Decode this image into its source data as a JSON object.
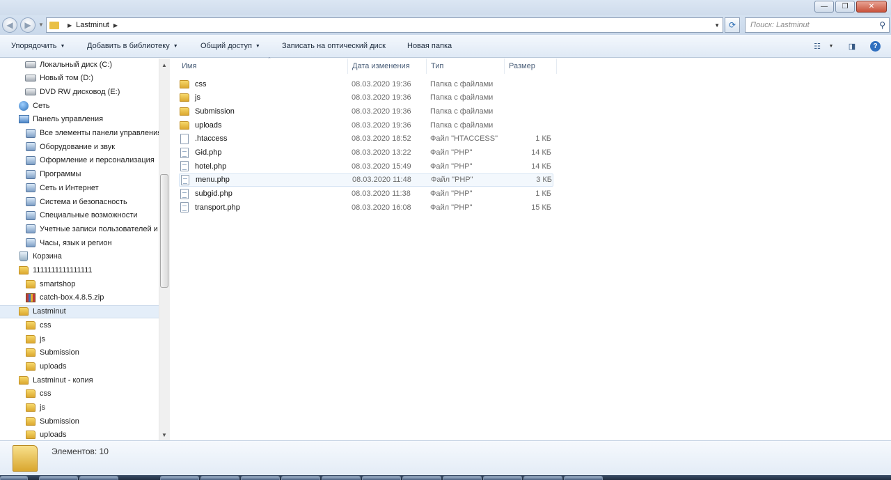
{
  "window": {
    "controls": {
      "minimize": "—",
      "maximize": "❐",
      "close": "✕"
    }
  },
  "address": {
    "path": [
      "Lastminut"
    ],
    "search_placeholder": "Поиск: Lastminut"
  },
  "toolbar": {
    "organize": "Упорядочить",
    "add_to_library": "Добавить в библиотеку",
    "share": "Общий доступ",
    "burn": "Записать на оптический диск",
    "new_folder": "Новая папка"
  },
  "sidebar": {
    "items": [
      {
        "label": "Локальный диск (C:)",
        "icon": "hard-drive-icon",
        "indent": 2
      },
      {
        "label": "Новый том (D:)",
        "icon": "drive-icon",
        "indent": 2
      },
      {
        "label": "DVD RW дисковод (E:)",
        "icon": "dvd-drive-icon",
        "indent": 2
      },
      {
        "label": "Сеть",
        "icon": "network-icon",
        "indent": 1
      },
      {
        "label": "Панель управления",
        "icon": "control-panel-icon",
        "indent": 1
      },
      {
        "label": "Все элементы панели управления",
        "icon": "control-panel-items-icon",
        "indent": 2
      },
      {
        "label": "Оборудование и звук",
        "icon": "hardware-sound-icon",
        "indent": 2
      },
      {
        "label": "Оформление и персонализация",
        "icon": "appearance-icon",
        "indent": 2
      },
      {
        "label": "Программы",
        "icon": "programs-icon",
        "indent": 2
      },
      {
        "label": "Сеть и Интернет",
        "icon": "network-internet-icon",
        "indent": 2
      },
      {
        "label": "Система и безопасность",
        "icon": "system-security-icon",
        "indent": 2
      },
      {
        "label": "Специальные возможности",
        "icon": "accessibility-icon",
        "indent": 2
      },
      {
        "label": "Учетные записи пользователей и",
        "icon": "user-accounts-icon",
        "indent": 2
      },
      {
        "label": "Часы, язык и регион",
        "icon": "clock-region-icon",
        "indent": 2
      },
      {
        "label": "Корзина",
        "icon": "recycle-bin-icon",
        "indent": 1
      },
      {
        "label": "1111111111111111",
        "icon": "folder-icon",
        "indent": 1
      },
      {
        "label": "smartshop",
        "icon": "folder-icon",
        "indent": 2
      },
      {
        "label": "catch-box.4.8.5.zip",
        "icon": "zip-archive-icon",
        "indent": 2
      },
      {
        "label": "Lastminut",
        "icon": "folder-icon",
        "indent": 1,
        "selected": true
      },
      {
        "label": "css",
        "icon": "folder-icon",
        "indent": 2
      },
      {
        "label": "js",
        "icon": "folder-icon",
        "indent": 2
      },
      {
        "label": "Submission",
        "icon": "folder-icon",
        "indent": 2
      },
      {
        "label": "uploads",
        "icon": "folder-icon",
        "indent": 2
      },
      {
        "label": "Lastminut - копия",
        "icon": "folder-icon",
        "indent": 1
      },
      {
        "label": "css",
        "icon": "folder-icon",
        "indent": 2
      },
      {
        "label": "js",
        "icon": "folder-icon",
        "indent": 2
      },
      {
        "label": "Submission",
        "icon": "folder-icon",
        "indent": 2
      },
      {
        "label": "uploads",
        "icon": "folder-icon",
        "indent": 2
      }
    ]
  },
  "columns": {
    "name": "Имя",
    "date": "Дата изменения",
    "type": "Тип",
    "size": "Размер"
  },
  "files": [
    {
      "name": "css",
      "date": "08.03.2020 19:36",
      "type": "Папка с файлами",
      "size": "",
      "kind": "folder"
    },
    {
      "name": "js",
      "date": "08.03.2020 19:36",
      "type": "Папка с файлами",
      "size": "",
      "kind": "folder"
    },
    {
      "name": "Submission",
      "date": "08.03.2020 19:36",
      "type": "Папка с файлами",
      "size": "",
      "kind": "folder"
    },
    {
      "name": "uploads",
      "date": "08.03.2020 19:36",
      "type": "Папка с файлами",
      "size": "",
      "kind": "folder"
    },
    {
      "name": ".htaccess",
      "date": "08.03.2020 18:52",
      "type": "Файл \"HTACCESS\"",
      "size": "1 КБ",
      "kind": "file"
    },
    {
      "name": "Gid.php",
      "date": "08.03.2020 13:22",
      "type": "Файл \"PHP\"",
      "size": "14 КБ",
      "kind": "php"
    },
    {
      "name": "hotel.php",
      "date": "08.03.2020 15:49",
      "type": "Файл \"PHP\"",
      "size": "14 КБ",
      "kind": "php"
    },
    {
      "name": "menu.php",
      "date": "08.03.2020 11:48",
      "type": "Файл \"PHP\"",
      "size": "3 КБ",
      "kind": "php",
      "hover": true
    },
    {
      "name": "subgid.php",
      "date": "08.03.2020 11:38",
      "type": "Файл \"PHP\"",
      "size": "1 КБ",
      "kind": "php"
    },
    {
      "name": "transport.php",
      "date": "08.03.2020 16:08",
      "type": "Файл \"PHP\"",
      "size": "15 КБ",
      "kind": "php"
    }
  ],
  "details": {
    "count_label": "Элементов: 10"
  },
  "colors": {
    "selection": "#e4eef9",
    "folder": "#e9c045",
    "toolbar": "#dfe9f5"
  }
}
